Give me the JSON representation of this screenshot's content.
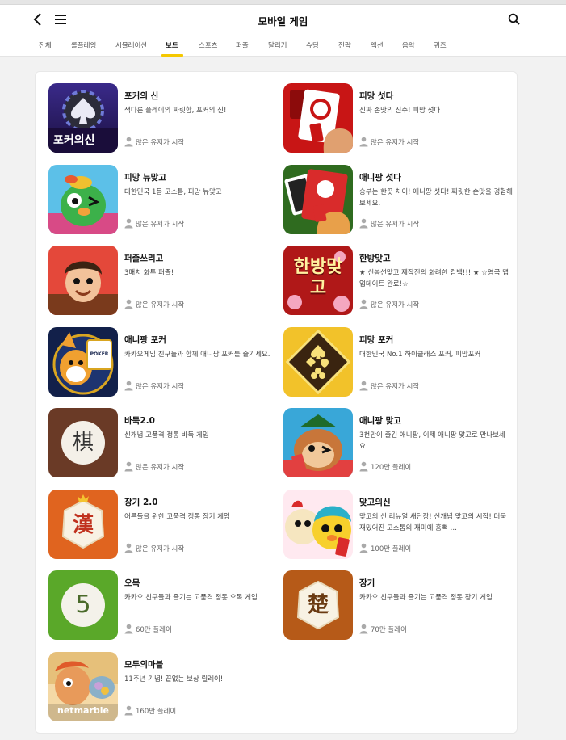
{
  "header": {
    "title": "모바일 게임"
  },
  "tabs": [
    {
      "label": "전체",
      "active": false
    },
    {
      "label": "롤플레잉",
      "active": false
    },
    {
      "label": "시뮬레이션",
      "active": false
    },
    {
      "label": "보드",
      "active": true
    },
    {
      "label": "스포츠",
      "active": false
    },
    {
      "label": "퍼즐",
      "active": false
    },
    {
      "label": "달리기",
      "active": false
    },
    {
      "label": "슈팅",
      "active": false
    },
    {
      "label": "전략",
      "active": false
    },
    {
      "label": "액션",
      "active": false
    },
    {
      "label": "음악",
      "active": false
    },
    {
      "label": "퀴즈",
      "active": false
    }
  ],
  "colors": {
    "accent_yellow": "#f5c800",
    "background": "#f2f2f2"
  },
  "games": [
    {
      "name": "포커의 신",
      "desc": "색다른 플레이의 짜릿함, 포커의 신!",
      "stat": "많은 유저가 시작",
      "icon": "poker-god-icon",
      "icon_text": "포커의신"
    },
    {
      "name": "피망 섯다",
      "desc": "진짜 손맛의 진수! 피망 섯다",
      "stat": "많은 유저가 시작",
      "icon": "pmang-sutda-icon",
      "icon_text": ""
    },
    {
      "name": "피망 뉴맞고",
      "desc": "대한민국 1등 고스톱, 피망 뉴맞고",
      "stat": "많은 유저가 시작",
      "icon": "pmang-newmatgo-icon",
      "icon_text": ""
    },
    {
      "name": "애니팡 섯다",
      "desc": "승부는 한끗 차이! 애니팡 섯다! 짜릿한 손맛을 경험해보세요.",
      "stat": "많은 유저가 시작",
      "icon": "anipang-sutda-icon",
      "icon_text": ""
    },
    {
      "name": "퍼즐쓰리고",
      "desc": "3매치 화투 퍼즐!",
      "stat": "많은 유저가 시작",
      "icon": "puzzle-threego-icon",
      "icon_text": ""
    },
    {
      "name": "한방맞고",
      "desc": "★ 신봉선맞고 제작진의 화려한 컴백!!! ★ ☆영국 맵 업데이트 완료!☆",
      "stat": "많은 유저가 시작",
      "icon": "hanbang-matgo-icon",
      "icon_text": "한방맞고"
    },
    {
      "name": "애니팡 포커",
      "desc": "카카오게임 친구들과 함께 애니팡 포커를 즐기세요.",
      "stat": "많은 유저가 시작",
      "icon": "anipang-poker-icon",
      "icon_text": "POKER"
    },
    {
      "name": "피망 포커",
      "desc": "대한민국 No.1 하이클래스 포커, 피망포커",
      "stat": "많은 유저가 시작",
      "icon": "pmang-poker-icon",
      "icon_text": ""
    },
    {
      "name": "바둑2.0",
      "desc": "신개념 고품격 정통 바둑 게임",
      "stat": "많은 유저가 시작",
      "icon": "baduk-icon",
      "icon_text": "棋"
    },
    {
      "name": "애니팡 맞고",
      "desc": "3천만이 즐긴 애니팡, 이제 애니팡 맞고로 만나보세요!",
      "stat": "120만 플레이",
      "icon": "anipang-matgo-icon",
      "icon_text": ""
    },
    {
      "name": "장기 2.0",
      "desc": "어른들을 위한 고품격 정통 장기 게임",
      "stat": "많은 유저가 시작",
      "icon": "janggi2-icon",
      "icon_text": "漢"
    },
    {
      "name": "맞고의신",
      "desc": "맞고의 신 리뉴얼 새단장! 신개념 맞고의 시작! 더욱 재밌어진 고스톱의 재미에 흠뻑 …",
      "stat": "100만 플레이",
      "icon": "matgo-god-icon",
      "icon_text": ""
    },
    {
      "name": "오목",
      "desc": "카카오 친구들과 즐기는 고품격 정통 오목 게임",
      "stat": "60만 플레이",
      "icon": "omok-icon",
      "icon_text": "5"
    },
    {
      "name": "장기",
      "desc": "카카오 친구들과 즐기는 고품격 정통 장기 게임",
      "stat": "70만 플레이",
      "icon": "janggi-icon",
      "icon_text": "楚"
    },
    {
      "name": "모두의마블",
      "desc": "11주년 기념! 끝없는 보상 릴레이!",
      "stat": "160만 플레이",
      "icon": "modoo-marble-icon",
      "icon_text": "netmarble"
    }
  ]
}
